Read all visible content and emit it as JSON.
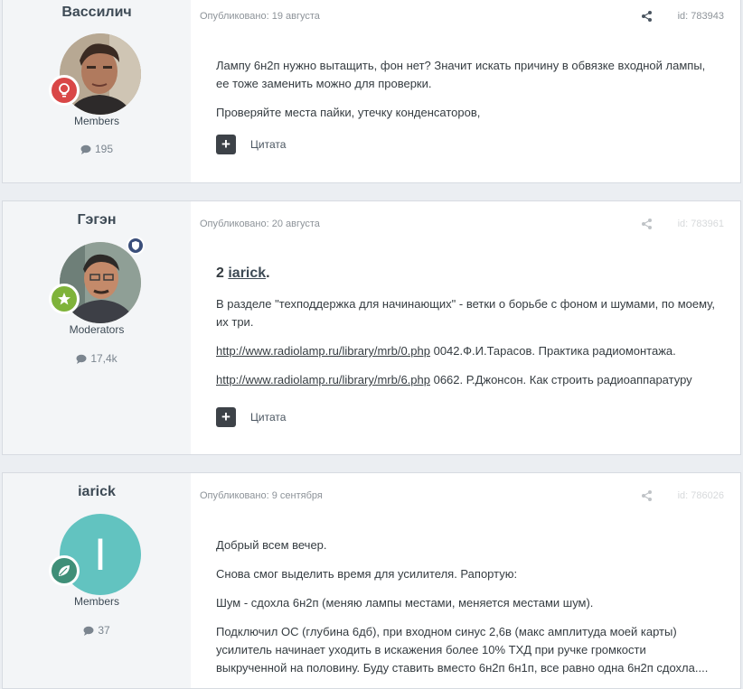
{
  "posts": [
    {
      "author": "Вассилич",
      "group": "Members",
      "post_count": "195",
      "published": "Опубликовано: 19 августа",
      "id": "id: 783943",
      "avatar_type": "photo-man-1",
      "rank_badge_icon": "lightbulb-icon",
      "rank_badge_color": "#d94747",
      "paragraphs": [
        "Лампу 6н2п нужно вытащить, фон нет? Значит искать причину в обвязке входной лампы, ее тоже заменить можно для проверки.",
        "Проверяйте места пайки, утечку конденсаторов,"
      ],
      "quote_label": "Цитата"
    },
    {
      "author": "Гэгэн",
      "group": "Moderators",
      "post_count": "17,4k",
      "published": "Опубликовано: 20 августа",
      "id": "id: 783961",
      "avatar_type": "photo-man-2",
      "rank_badge_icon": "star-icon",
      "rank_badge_color": "#7fb33a",
      "heading_prefix": "2 ",
      "heading_link": "iarick",
      "heading_suffix": ".",
      "paragraph1": "В разделе \"техподдержка для начинающих\" -  ветки о борьбе с фоном и шумами,  по моему, их три.",
      "link1_url": "http://www.radiolamp.ru/library/mrb/0.php",
      "link1_desc": "  0042.Ф.И.Тарасов.  Практика радиомонтажа.",
      "link2_url": "http://www.radiolamp.ru/library/mrb/6.php",
      "link2_desc": "  0662. Р.Джонсон. Как строить радиоаппаратуру",
      "quote_label": "Цитата"
    },
    {
      "author": "iarick",
      "group": "Members",
      "post_count": "37",
      "published": "Опубликовано: 9 сентября",
      "id": "id: 786026",
      "avatar_letter": "I",
      "avatar_color": "#62c3c0",
      "rank_badge_icon": "leaf-icon",
      "rank_badge_color": "#3f8f78",
      "paragraphs": [
        "Добрый всем вечер.",
        "Снова смог выделить время для усилителя. Рапортую:",
        "Шум - сдохла 6н2п (меняю лампы местами, меняется местами шум).",
        "Подключил ОС (глубина 6дб), при входном синус 2,6в (макс амплитуда моей карты) усилитель начинает уходить в искажения более 10% ТХД при ручке громкости выкрученной на половину. Буду ставить вместо 6н2п 6н1п, все равно одна 6н2п сдохла...."
      ]
    }
  ]
}
